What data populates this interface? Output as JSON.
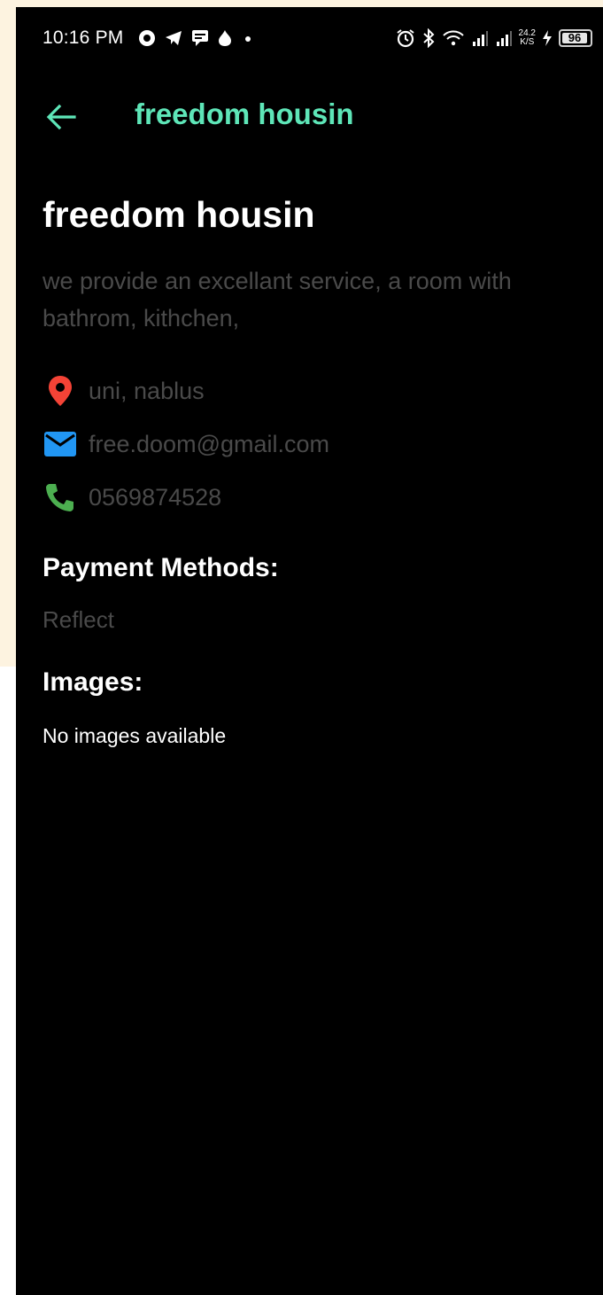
{
  "status_bar": {
    "time": "10:16 PM",
    "left_icons": [
      "browser-icon",
      "telegram-icon",
      "message-icon",
      "fire-icon",
      "dot-icon"
    ],
    "right_icons": [
      "alarm-icon",
      "bluetooth-icon",
      "wifi-icon",
      "signal-icon",
      "signal-icon"
    ],
    "speed_value": "24.2",
    "speed_unit": "K/S",
    "battery": "96"
  },
  "app_bar": {
    "title": "freedom housin",
    "accent_color": "#5ee6b8"
  },
  "listing": {
    "name": "freedom housin",
    "description": "we provide an excellant service, a room with bathrom, kithchen,",
    "location": "uni, nablus",
    "email": "free.doom@gmail.com",
    "phone": "0569874528"
  },
  "payment": {
    "title": "Payment Methods:",
    "value": "Reflect"
  },
  "images": {
    "title": "Images:",
    "empty_text": "No images available"
  },
  "colors": {
    "location_icon": "#f44336",
    "email_icon": "#2196f3",
    "phone_icon": "#4caf50"
  }
}
